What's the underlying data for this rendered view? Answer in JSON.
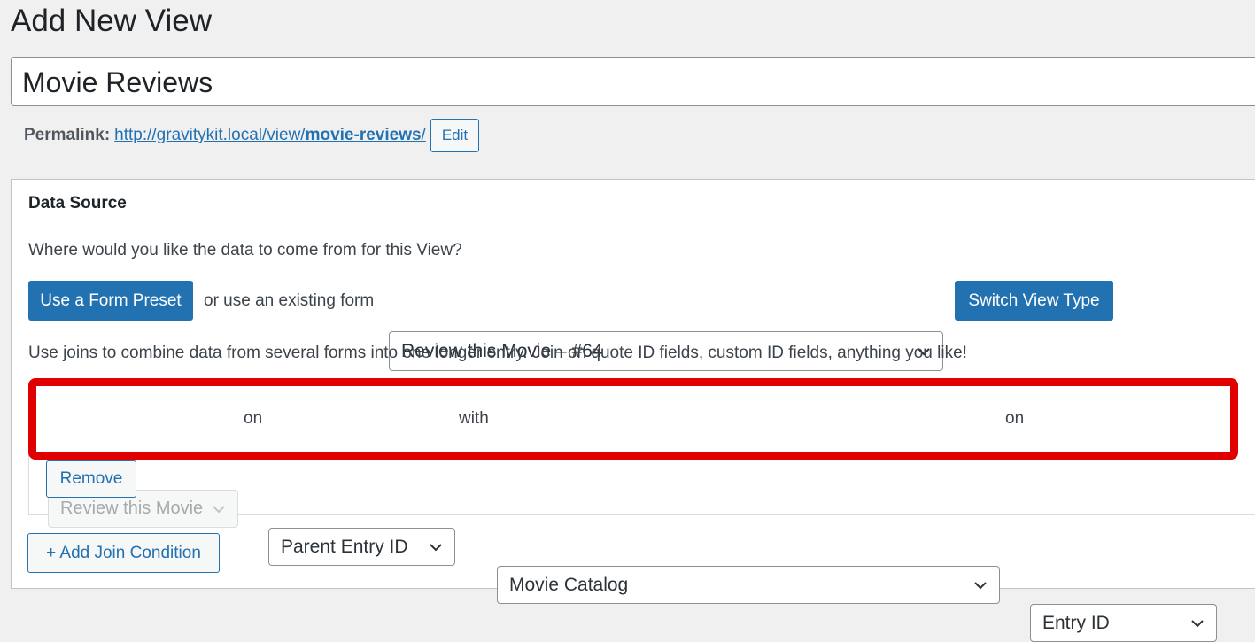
{
  "page": {
    "title": "Add New View"
  },
  "post_title": {
    "value": "Movie Reviews"
  },
  "permalink": {
    "label": "Permalink:",
    "url_prefix": "http://gravitykit.local/view/",
    "url_slug": "movie-reviews",
    "url_suffix": "/",
    "edit_label": "Edit"
  },
  "data_source": {
    "header": "Data Source",
    "question": "Where would you like the data to come from for this View?",
    "use_preset_label": "Use a Form Preset",
    "or_existing_label": "or use an existing form",
    "selected_form": "Review this Movie – #64",
    "switch_view_type_label": "Switch View Type",
    "joins_help": "Use joins to combine data from several forms into one longer entry. Join on quote ID fields, custom ID fields, anything you like!",
    "join": {
      "form_a": "Review this Movie",
      "on_label_1": "on",
      "field_a": "Parent Entry ID",
      "with_label": "with",
      "form_b": "Movie Catalog",
      "on_label_2": "on",
      "field_b": "Entry ID",
      "remove_label": "Remove"
    },
    "add_join_label": "+ Add Join Condition"
  },
  "colors": {
    "accent": "#2271b1",
    "highlight": "#e00000"
  }
}
